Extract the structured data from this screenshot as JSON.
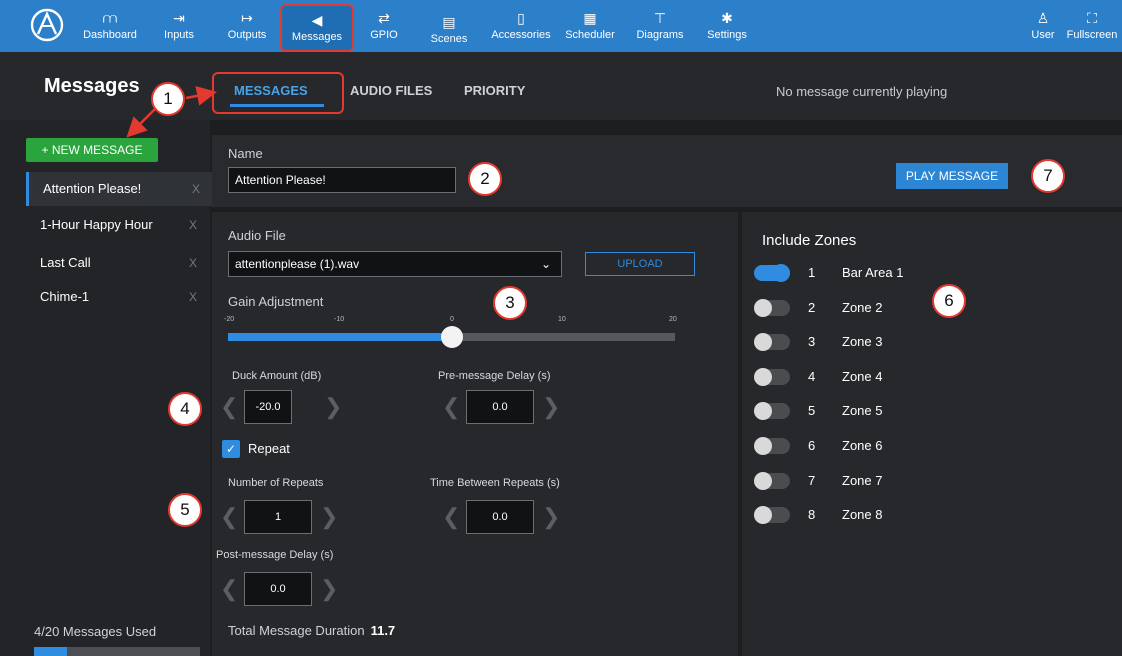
{
  "nav": {
    "items": [
      {
        "label": "Dashboard",
        "icon": "dashboard-icon",
        "glyph": "⩋"
      },
      {
        "label": "Inputs",
        "icon": "inputs-icon",
        "glyph": "⇥"
      },
      {
        "label": "Outputs",
        "icon": "outputs-icon",
        "glyph": "↦"
      },
      {
        "label": "Messages",
        "icon": "megaphone-icon",
        "glyph": "◀"
      },
      {
        "label": "GPIO",
        "icon": "gpio-icon",
        "glyph": "⇄"
      },
      {
        "label": "Scenes",
        "icon": "scenes-icon",
        "glyph": "▤"
      },
      {
        "label": "Accessories",
        "icon": "accessories-icon",
        "glyph": "▯"
      },
      {
        "label": "Scheduler",
        "icon": "calendar-icon",
        "glyph": "▦"
      },
      {
        "label": "Diagrams",
        "icon": "diagrams-icon",
        "glyph": "⊤"
      },
      {
        "label": "Settings",
        "icon": "gear-icon",
        "glyph": "✱"
      },
      {
        "label": "User",
        "icon": "user-icon",
        "glyph": "♙"
      },
      {
        "label": "Fullscreen",
        "icon": "fullscreen-icon",
        "glyph": "⛶"
      }
    ]
  },
  "header": {
    "title": "Messages",
    "tabs": [
      "MESSAGES",
      "AUDIO FILES",
      "PRIORITY"
    ],
    "status": "No message currently playing"
  },
  "sidebar": {
    "new_button": "+ NEW MESSAGE",
    "messages": [
      "Attention Please!",
      "1-Hour Happy Hour",
      "Last Call",
      "Chime-1"
    ],
    "delete_glyph": "X",
    "usage_text": "4/20 Messages Used",
    "usage_fraction": 0.2
  },
  "form": {
    "name_label": "Name",
    "name_value": "Attention Please!",
    "play_button": "PLAY MESSAGE",
    "audio_label": "Audio File",
    "audio_value": "attentionplease (1).wav",
    "upload_button": "UPLOAD",
    "gain_label": "Gain Adjustment",
    "gain_ticks": [
      "-20",
      "-10",
      "0",
      "10",
      "20"
    ],
    "gain_value": 0,
    "gain_min": -20,
    "gain_max": 20,
    "duck_label": "Duck Amount (dB)",
    "duck_value": "-20.0",
    "pre_delay_label": "Pre-message Delay (s)",
    "pre_delay_value": "0.0",
    "repeat_label": "Repeat",
    "repeat_checked": true,
    "repeats_label": "Number of Repeats",
    "repeats_value": "1",
    "between_label": "Time Between Repeats (s)",
    "between_value": "0.0",
    "post_delay_label": "Post-message Delay (s)",
    "post_delay_value": "0.0",
    "total_label": "Total Message Duration",
    "total_value": "11.7"
  },
  "zones": {
    "title": "Include Zones",
    "items": [
      {
        "num": "1",
        "name": "Bar Area 1",
        "on": true
      },
      {
        "num": "2",
        "name": "Zone 2",
        "on": false
      },
      {
        "num": "3",
        "name": "Zone 3",
        "on": false
      },
      {
        "num": "4",
        "name": "Zone 4",
        "on": false
      },
      {
        "num": "5",
        "name": "Zone 5",
        "on": false
      },
      {
        "num": "6",
        "name": "Zone 6",
        "on": false
      },
      {
        "num": "7",
        "name": "Zone 7",
        "on": false
      },
      {
        "num": "8",
        "name": "Zone 8",
        "on": false
      }
    ]
  },
  "callouts": [
    "1",
    "2",
    "3",
    "4",
    "5",
    "6",
    "7"
  ],
  "colors": {
    "nav": "#2c7fc9",
    "accent": "#2f8ce0",
    "new_button": "#2aa53e",
    "callout_border": "#e23a2f"
  }
}
